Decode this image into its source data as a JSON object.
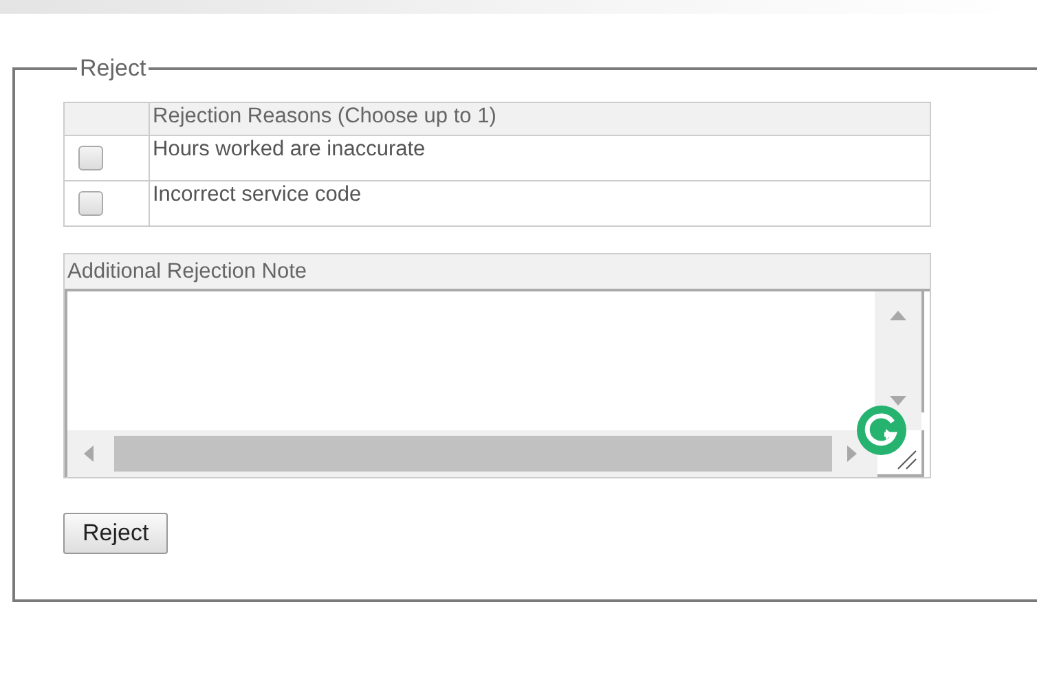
{
  "fieldset": {
    "legend": "Reject"
  },
  "reasons_table": {
    "header": "Rejection Reasons (Choose up to 1)",
    "rows": [
      {
        "label": "Hours worked are inaccurate",
        "checked": false
      },
      {
        "label": "Incorrect service code",
        "checked": false
      }
    ]
  },
  "note": {
    "label": "Additional Rejection Note"
  },
  "buttons": [
    "Reject"
  ]
}
